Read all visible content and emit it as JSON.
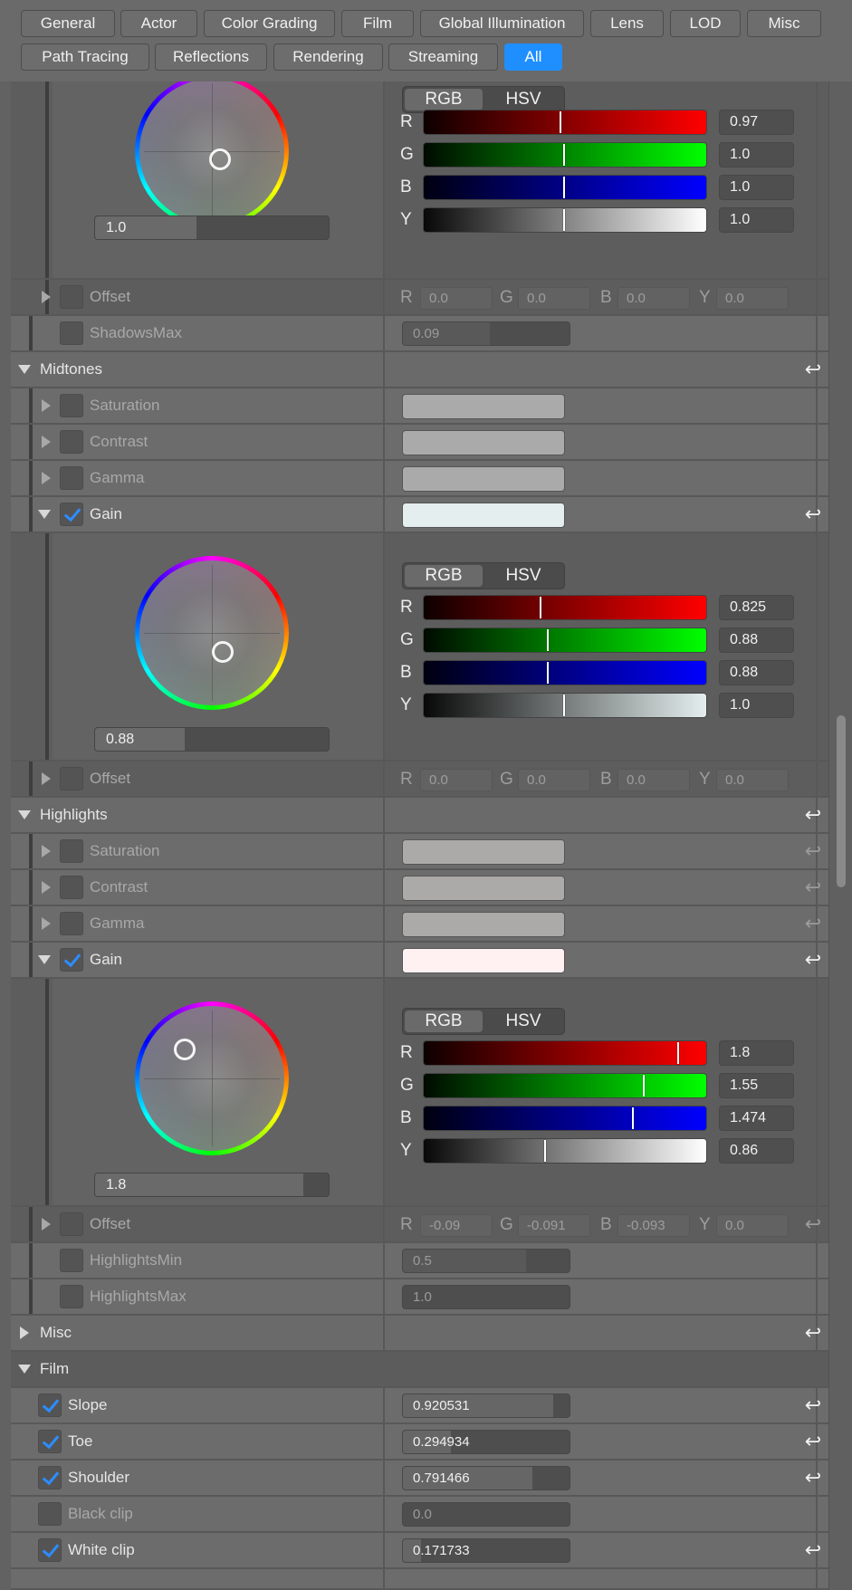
{
  "tabs": [
    {
      "label": "General"
    },
    {
      "label": "Actor"
    },
    {
      "label": "Color Grading"
    },
    {
      "label": "Film"
    },
    {
      "label": "Global Illumination"
    },
    {
      "label": "Lens"
    },
    {
      "label": "LOD"
    },
    {
      "label": "Misc"
    },
    {
      "label": "Path Tracing"
    },
    {
      "label": "Reflections"
    },
    {
      "label": "Rendering"
    },
    {
      "label": "Streaming"
    },
    {
      "label": "All"
    }
  ],
  "active_tab": "All",
  "mode_labels": {
    "rgb": "RGB",
    "hsv": "HSV"
  },
  "channel_labels": {
    "r": "R",
    "g": "G",
    "b": "B",
    "y": "Y"
  },
  "reset_icon": "↩",
  "colors": {
    "accent": "#1f8fff",
    "check": "#2d8dff"
  },
  "shadows": {
    "gain_picker": {
      "slider_value": "1.0",
      "r": "0.97",
      "g": "1.0",
      "b": "1.0",
      "y": "1.0",
      "wheel_offset": [
        0.1,
        0.2
      ]
    },
    "offset": {
      "label": "Offset",
      "r": "0.0",
      "g": "0.0",
      "b": "0.0",
      "y": "0.0"
    },
    "shadows_max": {
      "label": "ShadowsMax",
      "value": "0.09"
    }
  },
  "midtones": {
    "label": "Midtones",
    "saturation": {
      "label": "Saturation",
      "color": "#aaaaaa"
    },
    "contrast": {
      "label": "Contrast",
      "color": "#aaaaaa"
    },
    "gamma": {
      "label": "Gamma",
      "color": "#aaaaaa"
    },
    "gain": {
      "label": "Gain",
      "color": "#e4eeee",
      "checked": true
    },
    "gain_picker": {
      "slider_value": "0.88",
      "r": "0.825",
      "g": "0.88",
      "b": "0.88",
      "y": "1.0",
      "wheel_offset": [
        0.15,
        0.25
      ]
    },
    "offset": {
      "label": "Offset",
      "r": "0.0",
      "g": "0.0",
      "b": "0.0",
      "y": "0.0"
    }
  },
  "highlights": {
    "label": "Highlights",
    "saturation": {
      "label": "Saturation",
      "color": "#acaaa9"
    },
    "contrast": {
      "label": "Contrast",
      "color": "#acaaa9"
    },
    "gamma": {
      "label": "Gamma",
      "color": "#acaaa9"
    },
    "gain": {
      "label": "Gain",
      "color": "#fff1f1",
      "checked": true
    },
    "gain_picker": {
      "slider_value": "1.8",
      "r": "1.8",
      "g": "1.55",
      "b": "1.474",
      "y": "0.86",
      "wheel_offset": [
        -0.35,
        -0.36
      ]
    },
    "offset": {
      "label": "Offset",
      "r": "-0.09",
      "g": "-0.091",
      "b": "-0.093",
      "y": "0.0"
    },
    "highlights_min": {
      "label": "HighlightsMin",
      "value": "0.5"
    },
    "highlights_max": {
      "label": "HighlightsMax",
      "value": "1.0"
    }
  },
  "misc": {
    "label": "Misc"
  },
  "film": {
    "label": "Film",
    "slope": {
      "label": "Slope",
      "value": "0.920531",
      "checked": true
    },
    "toe": {
      "label": "Toe",
      "value": "0.294934",
      "checked": true
    },
    "shoulder": {
      "label": "Shoulder",
      "value": "0.791466",
      "checked": true
    },
    "black_clip": {
      "label": "Black clip",
      "value": "0.0",
      "checked": false
    },
    "white_clip": {
      "label": "White clip",
      "value": "0.171733",
      "checked": true
    }
  }
}
